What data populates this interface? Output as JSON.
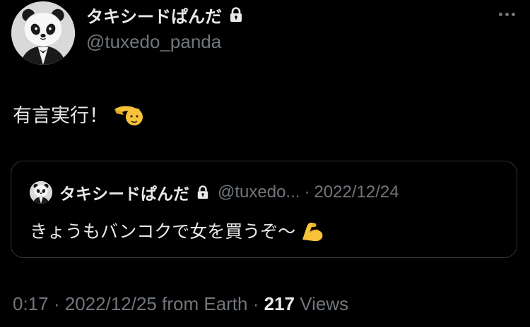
{
  "author": {
    "display_name": "タキシードぱんだ",
    "handle": "@tuxedo_panda",
    "avatar_icon": "panda-tuxedo-avatar",
    "protected_icon": "lock-icon"
  },
  "tweet": {
    "text": "有言実行！",
    "emoji_icon": "saluting-hand-emoji"
  },
  "quoted_tweet": {
    "display_name": "タキシードぱんだ",
    "handle": "@tuxedo...",
    "separator": "·",
    "date": "2022/12/24",
    "text": "きょうもバンコクで女を買うぞ〜",
    "emoji_icon": "flexed-biceps-emoji"
  },
  "meta": {
    "time": "0:17",
    "date": "2022/12/25",
    "source": "from Earth",
    "separator": "·",
    "views_count": "217",
    "views_label": "Views"
  },
  "colors": {
    "background": "#000000",
    "primary_text": "#e7e9ea",
    "secondary_text": "#71767b",
    "border": "#2f3336",
    "emoji_yellow": "#f6c23a"
  }
}
